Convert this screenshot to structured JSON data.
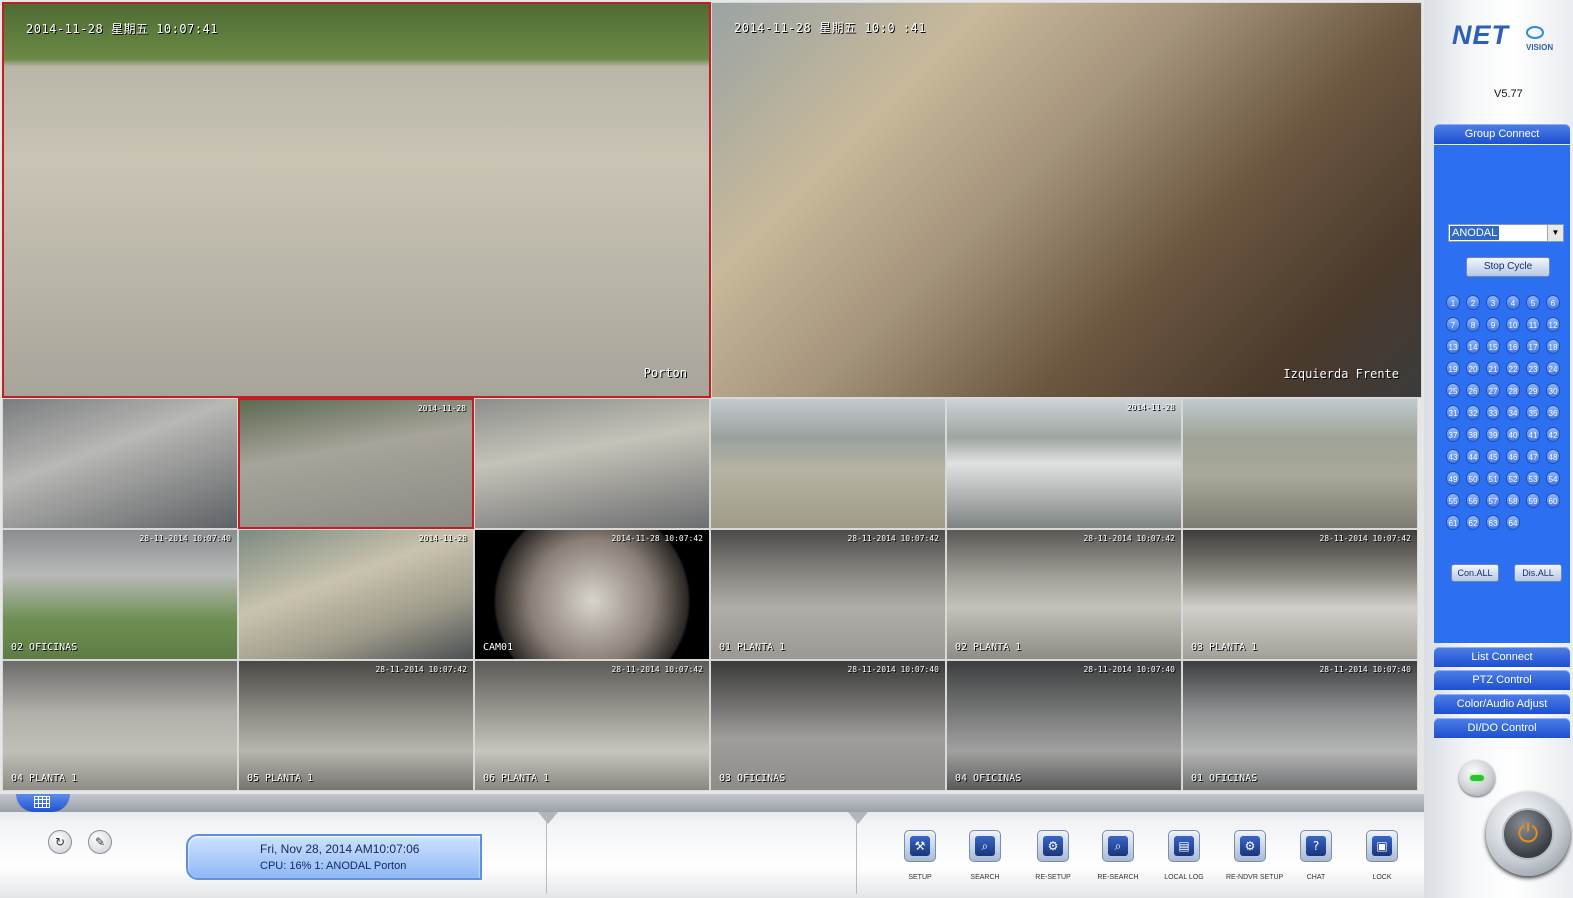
{
  "app": {
    "logo_text": "NET",
    "logo_sub": "VISION",
    "version": "V5.77"
  },
  "colors": {
    "panel_blue": "#2c6ff0",
    "header_blue": "#1d4fd2",
    "selected_border": "#c02020",
    "power_orange": "#f08a1a",
    "indicator_green": "#30c030"
  },
  "cameras": {
    "big": [
      {
        "timestamp": "2014-11-28 星期五 10:07:41",
        "name": "Porton",
        "bg": "linear-gradient(180deg,#4f6b34 0%,#6b8a45 14%,#b9b6a8 16%,#c9c4b4 40%,#b9b5a8 70%,#a7a49a 100%)"
      },
      {
        "timestamp": "2014-11-28 星期五 10:0 :41",
        "name": "Izquierda Frente",
        "bg": "linear-gradient(135deg,#9aa3a3 0%,#c8b99a 25%,#a3927a 45%,#6b5640 65%,#4a3a2c 85%,#3b3b3b 100%)"
      }
    ],
    "grid": [
      {
        "timestamp": "",
        "name": "",
        "bg": "linear-gradient(160deg,#7a7d80,#b8b8b4 40%,#5e6266)"
      },
      {
        "timestamp": "2014-11-28",
        "name": "",
        "bg": "linear-gradient(170deg,#5d6a52,#a7a49a 40%,#8c8a84)"
      },
      {
        "timestamp": "",
        "name": "",
        "bg": "linear-gradient(170deg,#8d8f8c,#c5c2b8 40%,#6c6e70)"
      },
      {
        "timestamp": "",
        "name": "",
        "bg": "linear-gradient(180deg,#c3c9cf 0%,#9aa19c 30%,#b6b3a2 55%,#9f9b88)"
      },
      {
        "timestamp": "2014-11-28",
        "name": "",
        "bg": "linear-gradient(180deg,#cdd3d8 0%,#9fa5a0 30%,#e0e2e2 50%,#7e8482)"
      },
      {
        "timestamp": "",
        "name": "",
        "bg": "linear-gradient(180deg,#c2c9cf 0%,#9ea496 30%,#a9a69a 60%,#7e7b70)"
      },
      {
        "timestamp": "28-11-2014 10:07:40",
        "name": "02 OFICINAS",
        "bg": "linear-gradient(180deg,#8a8d90 0%,#b7bab8 35%,#6e8f52 70%,#5e7d46)"
      },
      {
        "timestamp": "2014-11-28",
        "name": "",
        "bg": "linear-gradient(160deg,#7c8a80,#c9c3ae 40%,#9e9a8a 70%,#4a4f52)"
      },
      {
        "timestamp": "2014-11-28 10:07:42",
        "name": "CAM01",
        "bg": "radial-gradient(circle at 50% 55%,#d8d4cc 0%,#8a7f76 45%,#2a2624 70%,#000 72%)"
      },
      {
        "timestamp": "28-11-2014 10:07:42",
        "name": "01 PLANTA 1",
        "bg": "linear-gradient(180deg,#4c4a48 0%,#8b8884 35%,#b0ada8 60%,#9c9994)"
      },
      {
        "timestamp": "28-11-2014 10:07:42",
        "name": "02 PLANTA 1",
        "bg": "linear-gradient(180deg,#5a5754 0%,#a09c96 35%,#c4c1bb 60%,#8f8c86)"
      },
      {
        "timestamp": "28-11-2014 10:07:42",
        "name": "03 PLANTA 1",
        "bg": "linear-gradient(180deg,#3f3c3a 0%,#8a8680 35%,#d2cfca 60%,#a3a09a)"
      },
      {
        "timestamp": "",
        "name": "04 PLANTA 1",
        "bg": "linear-gradient(180deg,#6c6b69 0%,#b2afaa 40%,#c2bfb8 70%,#8f8c86)"
      },
      {
        "timestamp": "28-11-2014 10:07:42",
        "name": "05 PLANTA 1",
        "bg": "linear-gradient(180deg,#4a4845 0%,#8e8a84 40%,#b8b4ae 70%,#77736e)"
      },
      {
        "timestamp": "28-11-2014 10:07:42",
        "name": "06 PLANTA 1",
        "bg": "linear-gradient(180deg,#5c5a57 0%,#9b9892 40%,#c8c5bf 70%,#8a8781)"
      },
      {
        "timestamp": "28-11-2014 10:07:40",
        "name": "03 OFICINAS",
        "bg": "linear-gradient(180deg,#3a3a3a 0%,#6b6a68 30%,#9f9e9a 60%,#8d8c88)"
      },
      {
        "timestamp": "28-11-2014 10:07:40",
        "name": "04 OFICINAS",
        "bg": "linear-gradient(180deg,#3c3d3e 0%,#777878 40%,#a1a2a0 70%,#585958)"
      },
      {
        "timestamp": "28-11-2014 10:07:40",
        "name": "01 OFICINAS",
        "bg": "linear-gradient(180deg,#3d3e40 0%,#8e9092 40%,#b5b6b5 70%,#6f7072)"
      }
    ]
  },
  "panel": {
    "group_connect": "Group Connect",
    "group_selected": "ANODAL",
    "stop_cycle": "Stop Cycle",
    "channels": [
      "1",
      "2",
      "3",
      "4",
      "5",
      "6",
      "7",
      "8",
      "9",
      "10",
      "11",
      "12",
      "13",
      "14",
      "15",
      "16",
      "17",
      "18",
      "19",
      "20",
      "21",
      "22",
      "23",
      "24",
      "25",
      "26",
      "27",
      "28",
      "29",
      "30",
      "31",
      "32",
      "33",
      "34",
      "35",
      "36",
      "37",
      "38",
      "39",
      "40",
      "41",
      "42",
      "43",
      "44",
      "45",
      "46",
      "47",
      "48",
      "49",
      "50",
      "51",
      "52",
      "53",
      "54",
      "55",
      "56",
      "57",
      "58",
      "59",
      "60",
      "61",
      "62",
      "63",
      "64"
    ],
    "con_all": "Con.ALL",
    "dis_all": "Dis.ALL",
    "list_connect": "List Connect",
    "ptz_control": "PTZ Control",
    "color_audio": "Color/Audio Adjust",
    "dido_control": "DI/DO Control"
  },
  "status": {
    "datetime": "Fri, Nov 28, 2014  AM10:07:06",
    "info": "CPU: 16%  1:  ANODAL  Porton"
  },
  "toolbar": [
    {
      "label": "SETUP",
      "icon": "setup-icon",
      "glyph": "⚒"
    },
    {
      "label": "SEARCH",
      "icon": "search-icon",
      "glyph": "⌕"
    },
    {
      "label": "RE-SETUP",
      "icon": "re-setup-icon",
      "glyph": "⚙"
    },
    {
      "label": "RE-SEARCH",
      "icon": "re-search-icon",
      "glyph": "⌕"
    },
    {
      "label": "LOCAL LOG",
      "icon": "local-log-icon",
      "glyph": "▤"
    },
    {
      "label": "RE-NDVR SETUP",
      "icon": "re-ndvr-setup-icon",
      "glyph": "⚙"
    },
    {
      "label": "CHAT",
      "icon": "chat-icon",
      "glyph": "?"
    },
    {
      "label": "LOCK",
      "icon": "lock-icon",
      "glyph": "▣"
    }
  ]
}
